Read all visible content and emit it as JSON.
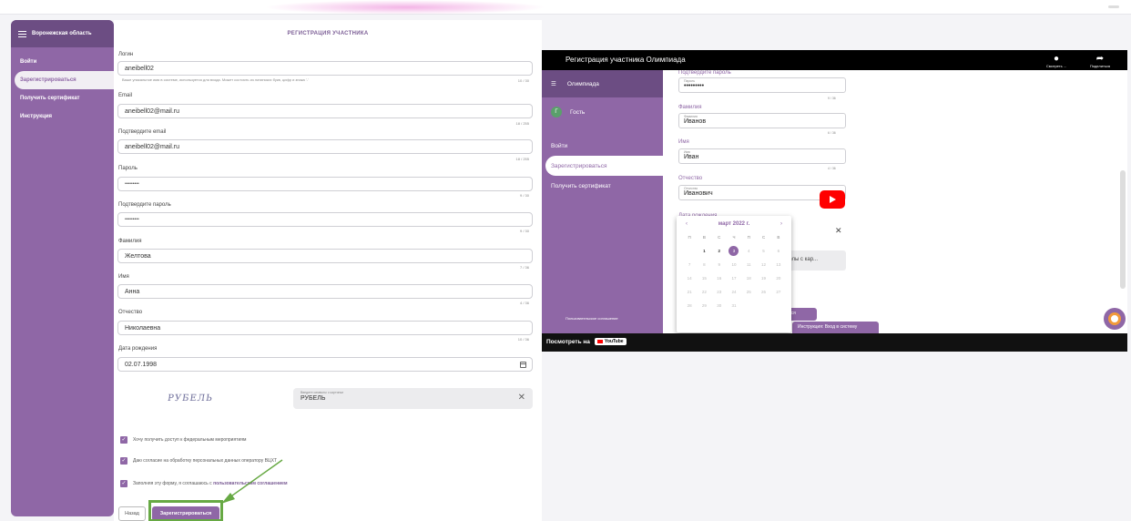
{
  "sidebar": {
    "region": "Воронежская область",
    "items": [
      {
        "label": "Войти"
      },
      {
        "label": "Зарегистрироваться"
      },
      {
        "label": "Получить сертификат"
      },
      {
        "label": "Инструкция"
      }
    ]
  },
  "form": {
    "title": "РЕГИСТРАЦИЯ УЧАСТНИКА",
    "login": {
      "label": "Логин",
      "value": "aneibell02",
      "hint": "Ваше уникальное имя в системе, используется для входа. Может состоять из латинских букв, цифр и знака '-'",
      "counter": "10 / 30"
    },
    "email": {
      "label": "Email",
      "value": "aneibell02@mail.ru",
      "counter": "18 / 255"
    },
    "email_confirm": {
      "label": "Подтвердите email",
      "value": "aneibell02@mail.ru",
      "counter": "18 / 255"
    },
    "password": {
      "label": "Пароль",
      "value": "•••••••••",
      "counter": "9 / 30"
    },
    "password_confirm": {
      "label": "Подтвердите пароль",
      "value": "•••••••••",
      "counter": "9 / 30"
    },
    "surname": {
      "label": "Фамилия",
      "value": "Желтова",
      "counter": "7 / 36"
    },
    "name": {
      "label": "Имя",
      "value": "Анна",
      "counter": "4 / 36"
    },
    "patronymic": {
      "label": "Отчество",
      "value": "Николаевна",
      "counter": "10 / 36"
    },
    "birthdate": {
      "label": "Дата рождения",
      "value": "02.07.1998"
    },
    "captcha": {
      "image_text": "РУБЕЛЬ",
      "placeholder": "Введите символы с картинки",
      "value": "РУБЕЛЬ"
    },
    "checkboxes": [
      {
        "text": "Хочу получить доступ к федеральным мероприятиям"
      },
      {
        "text": "Даю согласие на обработку персональных данных оператору ВЦХТ"
      },
      {
        "text": "Заполняя эту форму, я соглашаюсь с",
        "link": "пользовательским соглашением"
      }
    ],
    "back_button": "Назад",
    "submit_button": "Зарегистрироваться"
  },
  "video": {
    "title": "Регистрация участника Олимпиада",
    "watch_later": "Смотреть ...",
    "share": "Поделиться",
    "watch_on": "Посмотреть на",
    "youtube": "YouTube",
    "side_title": "Олимпиада",
    "guest": "Гость",
    "guest_initial": "Г",
    "side_items": [
      "Войти",
      "Зарегистрироваться",
      "Получить сертификат"
    ],
    "side_footer": "Пользовательское соглашение",
    "fields": {
      "pw_confirm_label": "Подтвердите пароль",
      "pw_ph": "Пароль",
      "pw_value": "•••••••••",
      "pw_counter": "9 / 36",
      "surname_label": "Фамилия",
      "surname_ph": "Фамилия",
      "surname_value": "Иванов",
      "surname_counter": "6 / 36",
      "name_label": "Имя",
      "name_ph": "Имя",
      "name_value": "Иван",
      "name_counter": "4 / 36",
      "patr_label": "Отчество",
      "patr_ph": "Отчество",
      "patr_value": "Иванович",
      "date_label": "Дата рождения"
    },
    "partial_text": "мволы с кар...",
    "pill1": "яться",
    "pill2": "Инструкция: Вход в систему",
    "calendar": {
      "month": "март 2022 г.",
      "weekdays": [
        "П",
        "В",
        "С",
        "Ч",
        "П",
        "С",
        "В"
      ],
      "days": [
        "",
        "1",
        "2",
        "3",
        "4",
        "5",
        "6",
        "7",
        "8",
        "9",
        "10",
        "11",
        "12",
        "13",
        "14",
        "15",
        "16",
        "17",
        "18",
        "19",
        "20",
        "21",
        "22",
        "23",
        "24",
        "25",
        "26",
        "27",
        "28",
        "29",
        "30",
        "31",
        "",
        "",
        ""
      ],
      "selected": "3"
    }
  }
}
